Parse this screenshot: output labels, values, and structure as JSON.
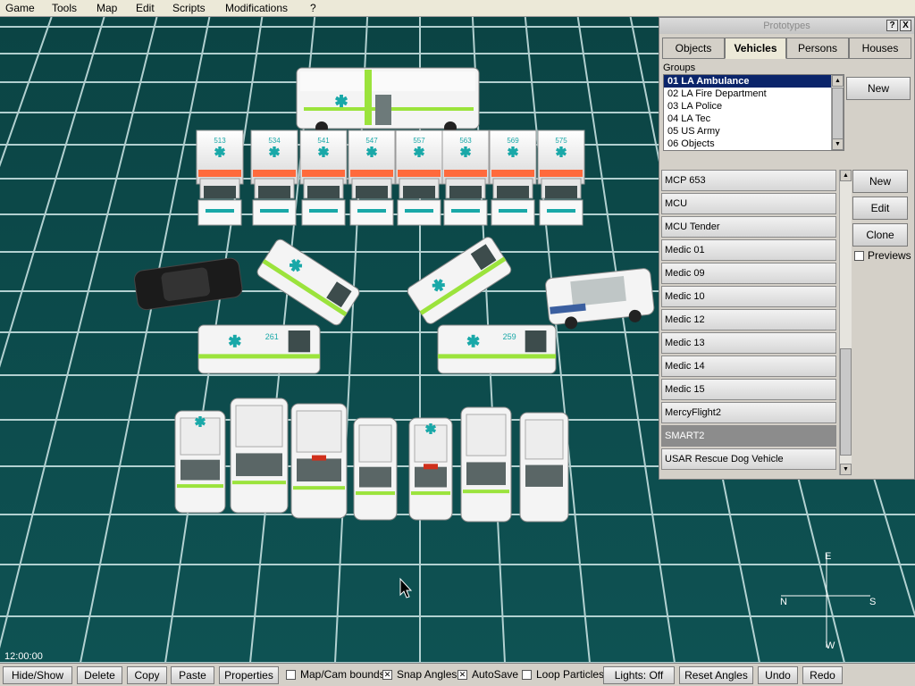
{
  "menu": [
    "Game",
    "Tools",
    "Map",
    "Edit",
    "Scripts",
    "Modifications",
    "?"
  ],
  "panel": {
    "title": "Prototypes",
    "help_label": "?",
    "close_label": "X",
    "tabs": [
      "Objects",
      "Vehicles",
      "Persons",
      "Houses"
    ],
    "active_tab": "Vehicles",
    "groups_label": "Groups",
    "groups": [
      "01 LA Ambulance",
      "02 LA Fire Department",
      "03 LA Police",
      "04 LA Tec",
      "05 US Army",
      "06 Objects"
    ],
    "selected_group": "01 LA Ambulance",
    "new_group_label": "New",
    "vehicles": [
      "MCP 653",
      "MCU",
      "MCU Tender",
      "Medic 01",
      "Medic 09",
      "Medic 10",
      "Medic 12",
      "Medic 13",
      "Medic 14",
      "Medic 15",
      "MercyFlight2",
      "SMART2",
      "USAR Rescue Dog Vehicle"
    ],
    "selected_vehicle": "SMART2",
    "new_label": "New",
    "edit_label": "Edit",
    "clone_label": "Clone",
    "previews_label": "Previews",
    "previews_checked": false
  },
  "viewport": {
    "time": "12:00:00",
    "compass": {
      "north": "N",
      "south": "S",
      "east": "E",
      "west": "W"
    },
    "bus_numbers": [
      "513",
      "534",
      "541",
      "547",
      "557",
      "563",
      "569",
      "575"
    ],
    "van_numbers": [
      "261",
      "259"
    ]
  },
  "toolbar": {
    "hide_show": "Hide/Show",
    "delete": "Delete",
    "copy": "Copy",
    "paste": "Paste",
    "properties": "Properties",
    "map_cam_bounds": {
      "label": "Map/Cam bounds",
      "checked": false
    },
    "snap_angles": {
      "label": "Snap Angles",
      "checked": true
    },
    "autosave": {
      "label": "AutoSave",
      "checked": true
    },
    "loop_particles": {
      "label": "Loop Particles",
      "checked": false
    },
    "lights": "Lights: Off",
    "reset_angles": "Reset Angles",
    "undo": "Undo",
    "redo": "Redo"
  },
  "colors": {
    "ground": "#0d4b4c",
    "grid": "#cfe8e8",
    "vehicle_white": "#f4f4f4",
    "vehicle_accent": "#9be33c",
    "star_of_life": "#19a8a8",
    "selection": "#0a246a"
  }
}
